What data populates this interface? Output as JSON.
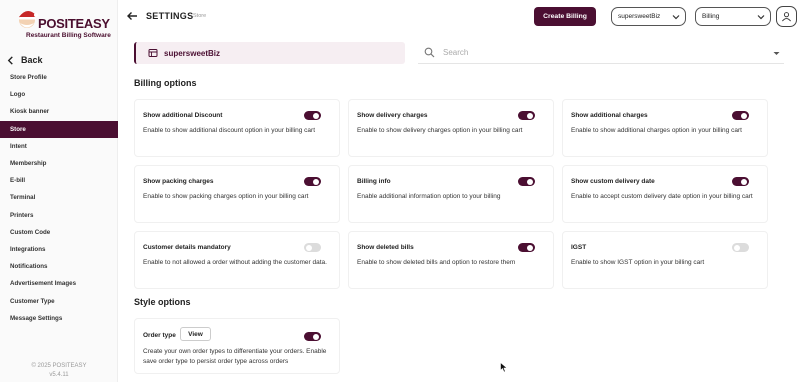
{
  "logo": {
    "brand": "POSITEASY",
    "subtitle": "Restaurant Billing Software"
  },
  "sidebar": {
    "back_label": "Back",
    "items": [
      {
        "label": "Store Profile",
        "active": false
      },
      {
        "label": "Logo",
        "active": false
      },
      {
        "label": "Kiosk banner",
        "active": false
      },
      {
        "label": "Store",
        "active": true
      },
      {
        "label": "Intent",
        "active": false
      },
      {
        "label": "Membership",
        "active": false
      },
      {
        "label": "E-bill",
        "active": false
      },
      {
        "label": "Terminal",
        "active": false
      },
      {
        "label": "Printers",
        "active": false
      },
      {
        "label": "Custom Code",
        "active": false
      },
      {
        "label": "Integrations",
        "active": false
      },
      {
        "label": "Notifications",
        "active": false
      },
      {
        "label": "Advertisement Images",
        "active": false
      },
      {
        "label": "Customer Type",
        "active": false
      },
      {
        "label": "Message Settings",
        "active": false
      }
    ],
    "copyright": "© 2025 POSITEASY",
    "version": "v5.4.11"
  },
  "header": {
    "title": "SETTINGS",
    "subtitle": "Store",
    "create_billing": "Create Billing",
    "store_select": "supersweetBiz",
    "mode_select": "Billing"
  },
  "store_chip": {
    "name": "supersweetBiz"
  },
  "search": {
    "placeholder": "Search",
    "value": ""
  },
  "billing_section": {
    "title": "Billing options",
    "cards": [
      {
        "title": "Show additional Discount",
        "desc": "Enable to show additional discount option in your billing cart",
        "on": true
      },
      {
        "title": "Show delivery charges",
        "desc": "Enable to show delivery charges option in your billing cart",
        "on": true
      },
      {
        "title": "Show additional charges",
        "desc": "Enable to show additional charges option in your billing cart",
        "on": true
      },
      {
        "title": "Show packing charges",
        "desc": "Enable to show packing charges option in your billing cart",
        "on": true
      },
      {
        "title": "Billing info",
        "desc": "Enable additional information option to your billing",
        "on": true
      },
      {
        "title": "Show custom delivery date",
        "desc": "Enable to accept custom delivery date option in your billing cart",
        "on": true
      },
      {
        "title": "Customer details mandatory",
        "desc": "Enable to not allowed a order without adding the customer data.",
        "on": false
      },
      {
        "title": "Show deleted bills",
        "desc": "Enable to show deleted bills and option to restore them",
        "on": true
      },
      {
        "title": "IGST",
        "desc": "Enable to show IGST option in your billing cart",
        "on": false
      }
    ]
  },
  "style_section": {
    "title": "Style options",
    "order_type": {
      "title": "Order type",
      "view_label": "View",
      "desc": "Create your own order types to differentiate your orders. Enable save order type to persist order type across orders",
      "on": true
    }
  },
  "colors": {
    "primary": "#4b0f32",
    "toggle_off": "#dcdcdc",
    "active_nav_text": "#ffffff"
  }
}
